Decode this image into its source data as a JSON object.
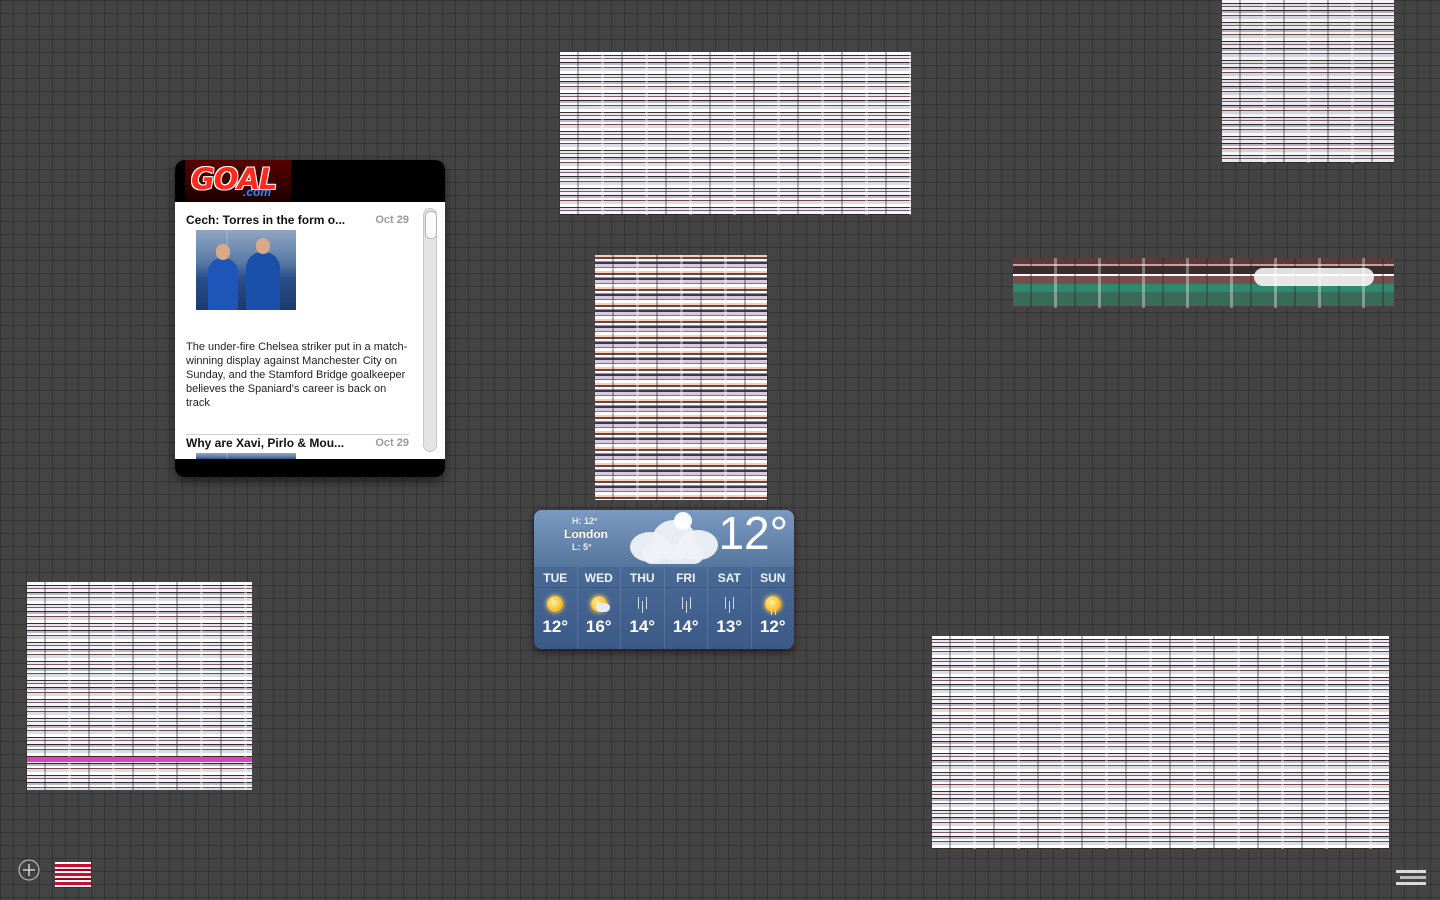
{
  "goal_widget": {
    "logo_main": "GOAL",
    "logo_suffix": ".com",
    "articles": [
      {
        "title": "Cech: Torres in the form o...",
        "date": "Oct 29",
        "body": "The under-fire Chelsea striker put in a match-winning display against Manchester City on Sunday, and the Stamford Bridge goalkeeper believes the Spaniard's career is back on track"
      },
      {
        "title": "Why are Xavi, Pirlo & Mou...",
        "date": "Oct 29"
      }
    ]
  },
  "weather_widget": {
    "city": "London",
    "high": "H: 12°",
    "low": "L: 5°",
    "current_temp": "12°",
    "current_icon": "cloud-icon",
    "forecast": [
      {
        "day": "TUE",
        "temp": "12°",
        "icon": "sun-icon"
      },
      {
        "day": "WED",
        "temp": "16°",
        "icon": "partly-cloudy-icon"
      },
      {
        "day": "THU",
        "temp": "14°",
        "icon": "rain-icon"
      },
      {
        "day": "FRI",
        "temp": "14°",
        "icon": "rain-icon"
      },
      {
        "day": "SAT",
        "temp": "13°",
        "icon": "rain-icon"
      },
      {
        "day": "SUN",
        "temp": "12°",
        "icon": "sun-rain-icon"
      }
    ]
  },
  "colors": {
    "desktop_background": "#444444",
    "weather_blue": "#4a6a96",
    "goal_red": "#ff2a1a"
  }
}
